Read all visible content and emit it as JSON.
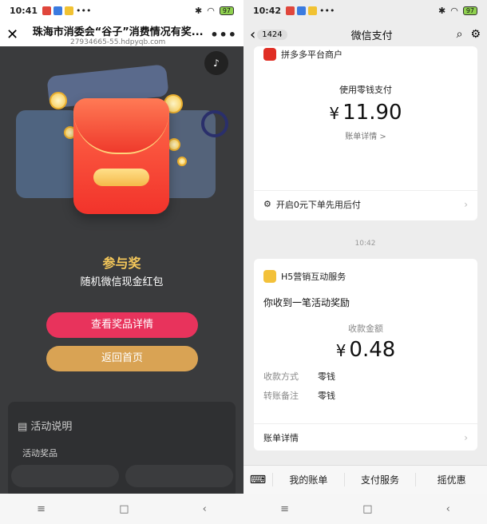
{
  "left": {
    "status": {
      "time": "10:41",
      "battery": "97"
    },
    "nav": {
      "title": "珠海市消委会“谷子”消费情况有奖...",
      "url": "27934665-55.hdpyqb.com"
    },
    "prize": {
      "title": "参与奖",
      "desc": "随机微信现金红包"
    },
    "buttons": {
      "view_prize": "查看奖品详情",
      "home": "返回首页"
    },
    "activity_desc": {
      "title": "活动说明",
      "subtitle": "活动奖品"
    }
  },
  "right": {
    "status": {
      "time": "10:42",
      "battery": "97"
    },
    "nav": {
      "badge": "1424",
      "title": "微信支付"
    },
    "card1": {
      "merchant": "拼多多平台商户",
      "pay_method": "使用零钱支付",
      "amount": "11.90",
      "detail_link": "账单详情 >",
      "footer": "开启0元下单先用后付"
    },
    "timestamp": "10:42",
    "card2": {
      "merchant": "H5营销互动服务",
      "message": "你收到一笔活动奖励",
      "amount_label": "收款金额",
      "amount": "0.48",
      "method_key": "收款方式",
      "method_val": "零钱",
      "note_key": "转账备注",
      "note_val": "零钱",
      "detail": "账单详情"
    },
    "bottom": {
      "item1": "我的账单",
      "item2": "支付服务",
      "item3": "摇优惠"
    }
  },
  "currency": "¥"
}
